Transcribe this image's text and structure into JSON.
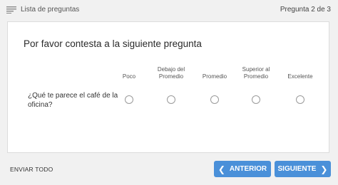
{
  "topbar": {
    "list_label": "Lista de preguntas",
    "page_counter": "Pregunta 2 de 3"
  },
  "survey": {
    "heading": "Por favor contesta a la siguiente pregunta",
    "columns": [
      "Poco",
      "Debajo del Promedio",
      "Promedio",
      "Superior al Promedio",
      "Excelente"
    ],
    "row_label": "¿Qué te parece el café de la oficina?"
  },
  "footer": {
    "submit_all": "ENVIAR TODO",
    "prev_label": "ANTERIOR",
    "next_label": "SIGUIENTE"
  },
  "colors": {
    "button": "#4a90d9",
    "background": "#f1f1f1"
  },
  "icons": {
    "list": "list-icon",
    "prev": "chevron-left-icon",
    "next": "chevron-right-icon"
  }
}
